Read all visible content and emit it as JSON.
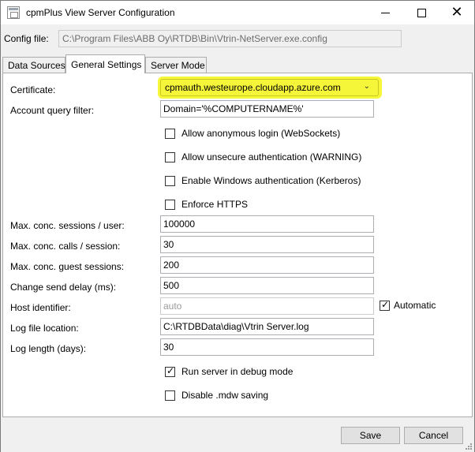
{
  "window": {
    "title": "cpmPlus View Server Configuration",
    "icon": "app-window-icon",
    "controls": {
      "minimize": "minimize-icon",
      "maximize": "maximize-icon",
      "close": "close-icon",
      "close_glyph": "✕"
    }
  },
  "config": {
    "label": "Config file:",
    "path": "C:\\Program Files\\ABB Oy\\RTDB\\Bin\\Vtrin-NetServer.exe.config"
  },
  "tabs": [
    {
      "label": "Data Sources",
      "active": false
    },
    {
      "label": "General Settings",
      "active": true
    },
    {
      "label": "Server Mode",
      "active": false
    }
  ],
  "general": {
    "certificate": {
      "label": "Certificate:",
      "value": "cpmauth.westeurope.cloudapp.azure.com",
      "highlight_color": "#f7f73a"
    },
    "account_filter": {
      "label": "Account query filter:",
      "value": "Domain='%COMPUTERNAME%'"
    },
    "checkboxes_top": [
      {
        "label": "Allow anonymous login (WebSockets)",
        "checked": false
      },
      {
        "label": "Allow unsecure authentication (WARNING)",
        "checked": false
      },
      {
        "label": "Enable Windows authentication (Kerberos)",
        "checked": false
      },
      {
        "label": "Enforce HTTPS",
        "checked": false
      }
    ],
    "fields": [
      {
        "label": "Max. conc. sessions / user:",
        "value": "100000"
      },
      {
        "label": "Max. conc. calls / session:",
        "value": "30"
      },
      {
        "label": "Max. conc. guest sessions:",
        "value": "200"
      },
      {
        "label": "Change send delay (ms):",
        "value": "500"
      },
      {
        "label": "Host identifier:",
        "value": "auto"
      },
      {
        "label": "Log file location:",
        "value": "C:\\RTDBData\\diag\\Vtrin Server.log"
      },
      {
        "label": "Log length (days):",
        "value": "30"
      }
    ],
    "automatic": {
      "label": "Automatic",
      "checked": true
    },
    "checkboxes_bottom": [
      {
        "label": "Run server in debug mode",
        "checked": true
      },
      {
        "label": "Disable .mdw saving",
        "checked": false
      }
    ]
  },
  "buttons": {
    "save": "Save",
    "cancel": "Cancel"
  }
}
